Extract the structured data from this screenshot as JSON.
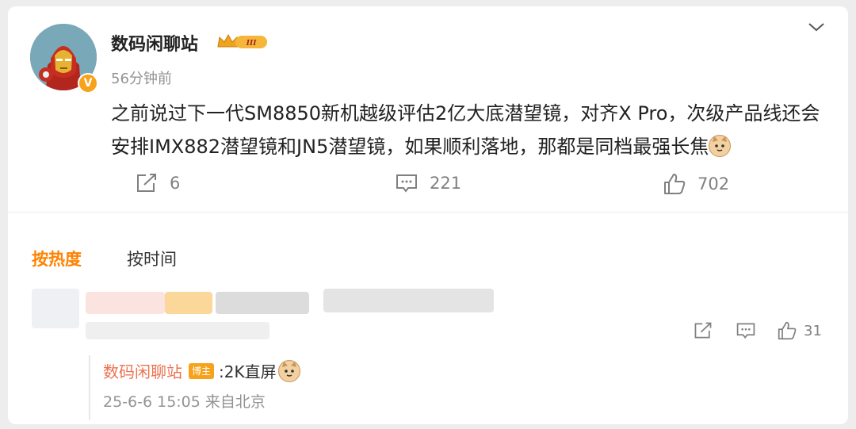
{
  "user": {
    "name": "数码闲聊站",
    "time": "56分钟前",
    "verified_badge": "V",
    "level_badge": "III"
  },
  "post": {
    "text": "之前说过下一代SM8850新机越级评估2亿大底潜望镜，对齐X Pro，次级产品线还会安排IMX882潜望镜和JN5潜望镜，如果顺利落地，那都是同档最强长焦"
  },
  "stats": {
    "reposts": "6",
    "comments": "221",
    "likes": "702"
  },
  "tabs": {
    "hot": "按热度",
    "time": "按时间"
  },
  "comment": {
    "likes": "31",
    "reply": {
      "name": "数码闲聊站",
      "badge": "博主",
      "text": ":2K直屏",
      "meta": "25-6-6 15:05 来自北京"
    }
  },
  "colors": {
    "accent": "#ff8200",
    "reply_name": "#eb7350",
    "badge": "#f7a21b",
    "muted": "#939393"
  },
  "icons": [
    "chevron-down-icon",
    "repost-icon",
    "comment-icon",
    "like-icon",
    "crown-icon",
    "cat-emoji-icon"
  ]
}
